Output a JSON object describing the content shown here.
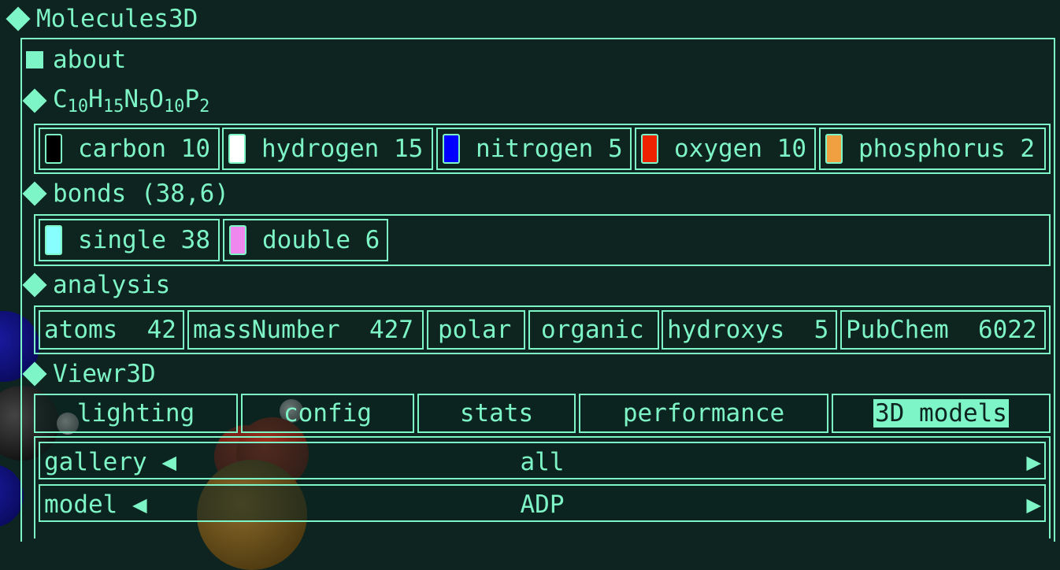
{
  "app_title": "Molecules3D",
  "about_label": "about",
  "formula": {
    "parts": [
      {
        "el": "C",
        "n": "10"
      },
      {
        "el": "H",
        "n": "15"
      },
      {
        "el": "N",
        "n": "5"
      },
      {
        "el": "O",
        "n": "10"
      },
      {
        "el": "P",
        "n": "2"
      }
    ]
  },
  "elements": [
    {
      "name": "carbon",
      "count": "10",
      "color": "#000000"
    },
    {
      "name": "hydrogen",
      "count": "15",
      "color": "#ffffff"
    },
    {
      "name": "nitrogen",
      "count": "5",
      "color": "#0000ff"
    },
    {
      "name": "oxygen",
      "count": "10",
      "color": "#ee2200"
    },
    {
      "name": "phosphorus",
      "count": "2",
      "color": "#f0a040"
    }
  ],
  "bonds": {
    "heading": "bonds (38,6)",
    "items": [
      {
        "name": "single",
        "count": "38",
        "color": "#88ffff"
      },
      {
        "name": "double",
        "count": "6",
        "color": "#ee88ee"
      }
    ]
  },
  "analysis": {
    "heading": "analysis",
    "items": [
      {
        "label": "atoms  42"
      },
      {
        "label": "massNumber  427"
      },
      {
        "label": "polar"
      },
      {
        "label": "organic"
      },
      {
        "label": "hydroxys  5"
      },
      {
        "label": "PubChem  6022"
      }
    ]
  },
  "viewer": {
    "heading": "Viewr3D",
    "tabs": [
      {
        "label": "lighting"
      },
      {
        "label": "config"
      },
      {
        "label": "stats"
      },
      {
        "label": "performance"
      },
      {
        "label": "3D models",
        "active": true
      }
    ]
  },
  "gallery": {
    "label": "gallery",
    "left_arrow": "◀",
    "value": "all",
    "right_arrow": "▶"
  },
  "model": {
    "label": "model",
    "left_arrow": "◀",
    "value": "ADP",
    "right_arrow": "▶"
  }
}
